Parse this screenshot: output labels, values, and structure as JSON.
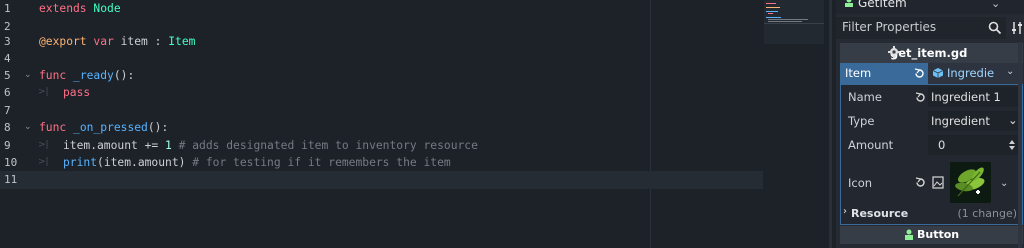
{
  "editor": {
    "lines": [
      {
        "n": "1"
      },
      {
        "n": "2"
      },
      {
        "n": "3"
      },
      {
        "n": "4"
      },
      {
        "n": "5"
      },
      {
        "n": "6"
      },
      {
        "n": "7"
      },
      {
        "n": "8"
      },
      {
        "n": "9"
      },
      {
        "n": "10"
      },
      {
        "n": "11"
      }
    ],
    "code": {
      "l1_kw": "extends",
      "l1_type": "Node",
      "l3_ann": "@export",
      "l3_kw": "var",
      "l3_rest": " item : ",
      "l3_type": "Item",
      "l5_kw": "func",
      "l5_fn": "_ready",
      "l5_rest": "():",
      "l6_kw": "pass",
      "l8_kw": "func",
      "l8_fn": "_on_pressed",
      "l8_rest": "():",
      "l9_a": "item.amount += ",
      "l9_num": "1",
      "l9_cm": " # adds designated item to inventory resource",
      "l10_fn": "print",
      "l10_rest": "(item.amount)",
      "l10_cm": " # for testing if it remembers the item"
    }
  },
  "inspector": {
    "node_name": "GetItem",
    "filter_placeholder": "Filter Properties",
    "script_section": "get_item.gd",
    "item_label": "Item",
    "item_value": "Ingredie",
    "props": {
      "name_label": "Name",
      "name_value": "Ingredient 1",
      "type_label": "Type",
      "type_value": "Ingredient",
      "amount_label": "Amount",
      "amount_value": "0",
      "icon_label": "Icon"
    },
    "resource_label": "Resource",
    "resource_changes": "(1 change)",
    "bottom_section": "Button"
  },
  "icons": [
    "node-icon",
    "search-icon",
    "tool-icon",
    "gear-icon",
    "revert-icon",
    "resource-icon",
    "chevron-down-icon",
    "icon-thumbnail"
  ],
  "colors": {
    "keyword": "#ff7085",
    "type": "#42ffc2",
    "function": "#57b3ff",
    "comment": "#757a82",
    "selected": "#3a6a99"
  }
}
